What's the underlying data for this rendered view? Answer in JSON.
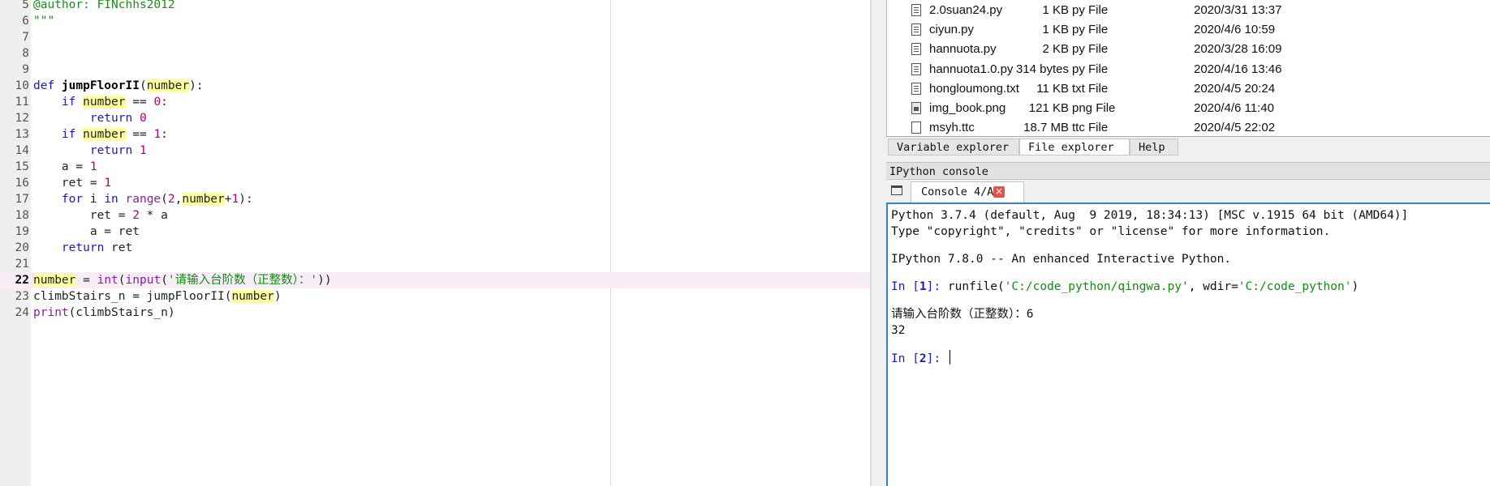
{
  "editor": {
    "lines": [
      {
        "num": "5",
        "tokens": [
          {
            "t": "@author: FINchhs2012",
            "c": "g"
          }
        ]
      },
      {
        "num": "6",
        "tokens": [
          {
            "t": "\"\"\"",
            "c": "g"
          }
        ]
      },
      {
        "num": "7",
        "tokens": []
      },
      {
        "num": "8",
        "tokens": []
      },
      {
        "num": "9",
        "tokens": []
      },
      {
        "num": "10",
        "tokens": [
          {
            "t": "def ",
            "c": "k"
          },
          {
            "t": "jumpFloorII",
            "c": "f"
          },
          {
            "t": "("
          },
          {
            "t": "number",
            "c": "hl"
          },
          {
            "t": "):"
          }
        ]
      },
      {
        "num": "11",
        "tokens": [
          {
            "t": "    "
          },
          {
            "t": "if ",
            "c": "k"
          },
          {
            "t": "number",
            "c": "hl"
          },
          {
            "t": " == "
          },
          {
            "t": "0",
            "c": "n"
          },
          {
            "t": ":"
          }
        ]
      },
      {
        "num": "12",
        "tokens": [
          {
            "t": "        "
          },
          {
            "t": "return ",
            "c": "k"
          },
          {
            "t": "0",
            "c": "n"
          }
        ]
      },
      {
        "num": "13",
        "tokens": [
          {
            "t": "    "
          },
          {
            "t": "if ",
            "c": "k"
          },
          {
            "t": "number",
            "c": "hl"
          },
          {
            "t": " == "
          },
          {
            "t": "1",
            "c": "n"
          },
          {
            "t": ":"
          }
        ]
      },
      {
        "num": "14",
        "tokens": [
          {
            "t": "        "
          },
          {
            "t": "return ",
            "c": "k"
          },
          {
            "t": "1",
            "c": "n"
          }
        ]
      },
      {
        "num": "15",
        "tokens": [
          {
            "t": "    a = "
          },
          {
            "t": "1",
            "c": "n"
          }
        ]
      },
      {
        "num": "16",
        "tokens": [
          {
            "t": "    ret = "
          },
          {
            "t": "1",
            "c": "n"
          }
        ]
      },
      {
        "num": "17",
        "tokens": [
          {
            "t": "    "
          },
          {
            "t": "for ",
            "c": "k"
          },
          {
            "t": "i "
          },
          {
            "t": "in ",
            "c": "k"
          },
          {
            "t": "range",
            "c": "b"
          },
          {
            "t": "("
          },
          {
            "t": "2",
            "c": "n"
          },
          {
            "t": ","
          },
          {
            "t": "number",
            "c": "hl"
          },
          {
            "t": "+"
          },
          {
            "t": "1",
            "c": "n"
          },
          {
            "t": "):"
          }
        ]
      },
      {
        "num": "18",
        "tokens": [
          {
            "t": "        ret = "
          },
          {
            "t": "2",
            "c": "n"
          },
          {
            "t": " * a"
          }
        ]
      },
      {
        "num": "19",
        "tokens": [
          {
            "t": "        a = ret"
          }
        ]
      },
      {
        "num": "20",
        "tokens": [
          {
            "t": "    "
          },
          {
            "t": "return ",
            "c": "k"
          },
          {
            "t": "ret"
          }
        ]
      },
      {
        "num": "21",
        "tokens": []
      },
      {
        "num": "22",
        "current": true,
        "tokens": [
          {
            "t": "number",
            "c": "hl"
          },
          {
            "t": " = "
          },
          {
            "t": "int",
            "c": "b"
          },
          {
            "t": "("
          },
          {
            "t": "input",
            "c": "b"
          },
          {
            "t": "("
          },
          {
            "t": "'请输入台阶数（正整数）：'",
            "c": "s"
          },
          {
            "t": "))"
          }
        ]
      },
      {
        "num": "23",
        "tokens": [
          {
            "t": "climbStairs_n = jumpFloorII("
          },
          {
            "t": "number",
            "c": "hl"
          },
          {
            "t": ")"
          }
        ]
      },
      {
        "num": "24",
        "tokens": [
          {
            "t": "print",
            "c": "b"
          },
          {
            "t": "(climbStairs_n)"
          }
        ]
      }
    ]
  },
  "files": [
    {
      "name": "2.0suan24.py",
      "size": "1 KB",
      "type": "py File",
      "date": "2020/3/31 13:37",
      "icon": "text-file-icon"
    },
    {
      "name": "ciyun.py",
      "size": "1 KB",
      "type": "py File",
      "date": "2020/4/6 10:59",
      "icon": "text-file-icon"
    },
    {
      "name": "hannuota.py",
      "size": "2 KB",
      "type": "py File",
      "date": "2020/3/28 16:09",
      "icon": "text-file-icon"
    },
    {
      "name": "hannuota1.0.py",
      "size": "314 bytes",
      "type": "py File",
      "date": "2020/4/16 13:46",
      "icon": "text-file-icon"
    },
    {
      "name": "hongloumong.txt",
      "size": "11 KB",
      "type": "txt File",
      "date": "2020/4/5 20:24",
      "icon": "text-file-icon"
    },
    {
      "name": "img_book.png",
      "size": "121 KB",
      "type": "png File",
      "date": "2020/4/6 11:40",
      "icon": "image-file-icon"
    },
    {
      "name": "msyh.ttc",
      "size": "18.7 MB",
      "type": "ttc File",
      "date": "2020/4/5 22:02",
      "icon": "blank-file-icon"
    }
  ],
  "pane_tabs": {
    "variable": "Variable explorer",
    "file": "File explorer",
    "help": "Help"
  },
  "console": {
    "title": "IPython console",
    "tab_label": "Console 4/A",
    "close_glyph": "×",
    "banner1": "Python 3.7.4 (default, Aug  9 2019, 18:34:13) [MSC v.1915 64 bit (AMD64)]",
    "banner2": "Type \"copyright\", \"credits\" or \"license\" for more information.",
    "banner3": "IPython 7.8.0 -- An enhanced Interactive Python.",
    "prompt1_pre": "In [",
    "prompt1_num": "1",
    "prompt1_post": "]: ",
    "cmd_a": "runfile(",
    "cmd_str1": "'C:/code_python/qingwa.py'",
    "cmd_b": ", wdir=",
    "cmd_str2": "'C:/code_python'",
    "cmd_c": ")",
    "input_prompt": "请输入台阶数（正整数）：6",
    "output": "32",
    "prompt2_pre": "In [",
    "prompt2_num": "2",
    "prompt2_post": "]: "
  }
}
